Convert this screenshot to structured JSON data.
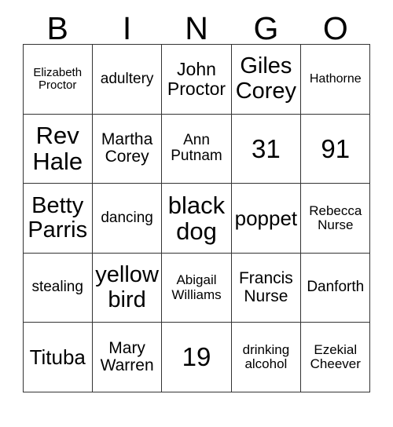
{
  "card": {
    "header_letters": [
      "B",
      "I",
      "N",
      "G",
      "O"
    ],
    "columns": 5,
    "rows": 5,
    "border_color": "#333333",
    "text_color": "#000000",
    "background_color": "#ffffff",
    "cells": [
      [
        {
          "text": "Elizabeth Proctor",
          "size": "fs-xs"
        },
        {
          "text": "adultery",
          "size": "fs-m"
        },
        {
          "text": "John Proctor",
          "size": "fs-l"
        },
        {
          "text": "Giles Corey",
          "size": "fs-xxl"
        },
        {
          "text": "Hathorne",
          "size": "fs-s"
        }
      ],
      [
        {
          "text": "Rev Hale",
          "size": "fs-3xl"
        },
        {
          "text": "Martha Corey",
          "size": "fs-ml"
        },
        {
          "text": "Ann Putnam",
          "size": "fs-m"
        },
        {
          "text": "31",
          "size": "fs-num"
        },
        {
          "text": "91",
          "size": "fs-num"
        }
      ],
      [
        {
          "text": "Betty Parris",
          "size": "fs-xxl"
        },
        {
          "text": "dancing",
          "size": "fs-m"
        },
        {
          "text": "black dog",
          "size": "fs-3xl"
        },
        {
          "text": "poppet",
          "size": "fs-xl"
        },
        {
          "text": "Rebecca Nurse",
          "size": "fs-sm"
        }
      ],
      [
        {
          "text": "stealing",
          "size": "fs-m"
        },
        {
          "text": "yellow bird",
          "size": "fs-xxl"
        },
        {
          "text": "Abigail Williams",
          "size": "fs-sm"
        },
        {
          "text": "Francis Nurse",
          "size": "fs-ml"
        },
        {
          "text": "Danforth",
          "size": "fs-m"
        }
      ],
      [
        {
          "text": "Tituba",
          "size": "fs-xl"
        },
        {
          "text": "Mary Warren",
          "size": "fs-ml"
        },
        {
          "text": "19",
          "size": "fs-num"
        },
        {
          "text": "drinking alcohol",
          "size": "fs-sm"
        },
        {
          "text": "Ezekial Cheever",
          "size": "fs-sm"
        }
      ]
    ]
  }
}
